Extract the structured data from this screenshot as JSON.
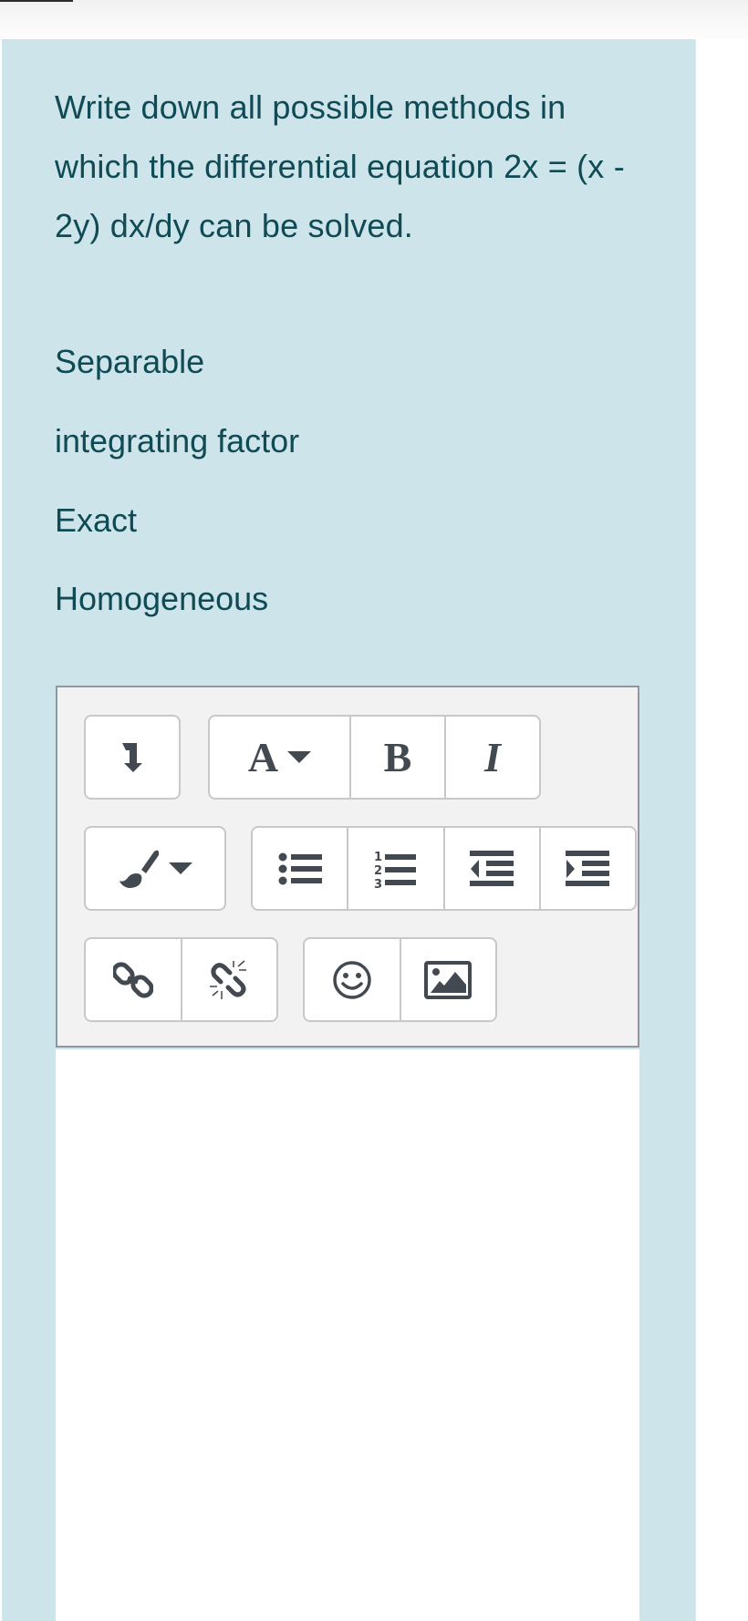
{
  "page": {
    "colors": {
      "panel_background": "#cde5ea",
      "text": "#0f4a55",
      "toolbar_background": "#f2f2f2",
      "icon": "#434950"
    }
  },
  "question": {
    "text": "Write down all possible methods in which the differential equation 2x = (x - 2y) dx/dy  can be solved."
  },
  "options": [
    {
      "label": "Separable"
    },
    {
      "label": "integrating factor"
    },
    {
      "label": "Exact"
    },
    {
      "label": "Homogeneous"
    }
  ],
  "editor": {
    "toolbar": {
      "rows": [
        [
          {
            "icon": "collapse-toolbar-icon"
          },
          {
            "icon": "font-style-icon",
            "label": "A"
          },
          {
            "icon": "bold-icon",
            "label": "B"
          },
          {
            "icon": "italic-icon",
            "label": "I"
          }
        ],
        [
          {
            "icon": "paint-brush-icon"
          },
          {
            "icon": "unordered-list-icon"
          },
          {
            "icon": "ordered-list-icon",
            "numbers": [
              "1",
              "2",
              "3"
            ]
          },
          {
            "icon": "outdent-icon"
          },
          {
            "icon": "indent-icon"
          }
        ],
        [
          {
            "icon": "link-icon"
          },
          {
            "icon": "unlink-icon"
          },
          {
            "icon": "emoticon-icon"
          },
          {
            "icon": "image-icon"
          }
        ]
      ]
    },
    "content": ""
  }
}
